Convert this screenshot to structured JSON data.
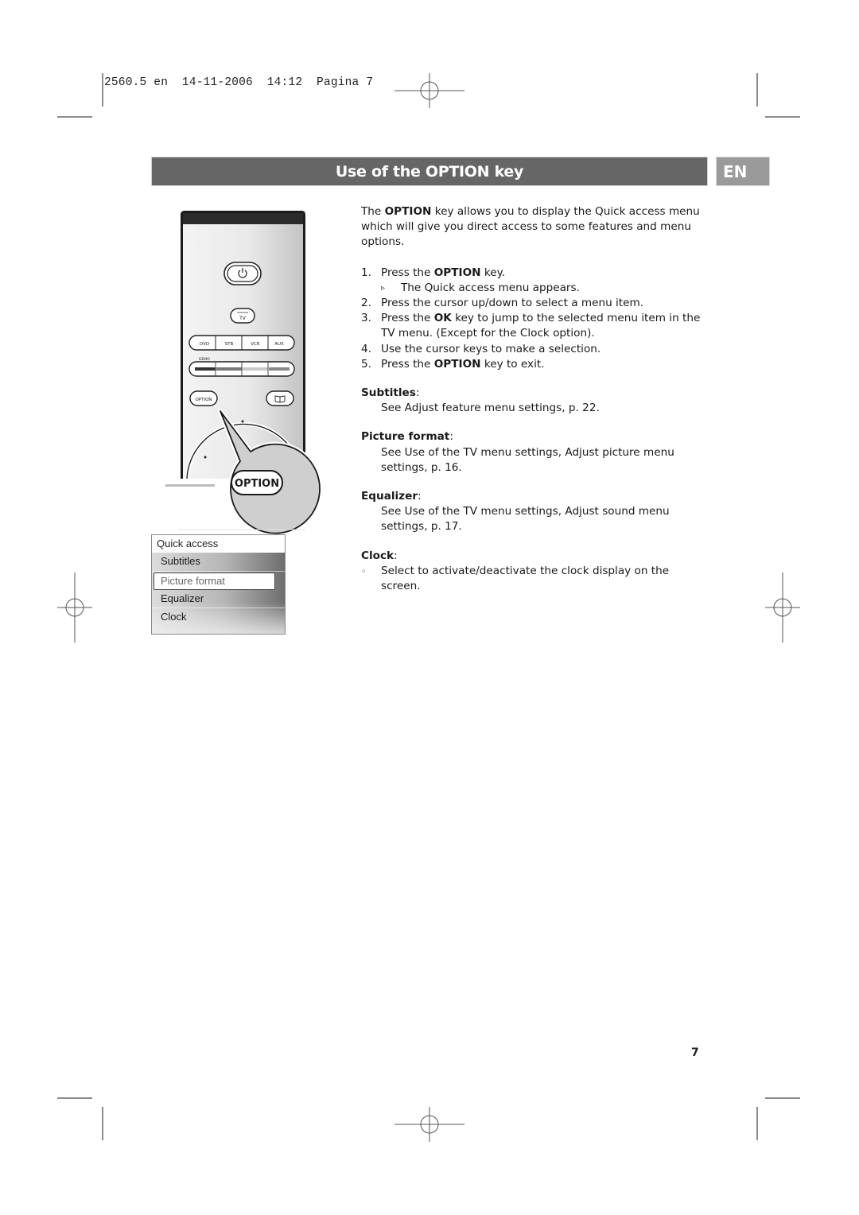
{
  "slug": {
    "text": "2560.5 en  14-11-2006  14:12  Pagina 7"
  },
  "header": {
    "title": "Use of the OPTION key",
    "language_badge": "EN"
  },
  "remote": {
    "buttons": {
      "power_icon": "power-icon",
      "tv": "TV",
      "sources": [
        "DVD",
        "STB",
        "VCR",
        "AUX"
      ],
      "demo_label": "DEMO",
      "option_small": "OPTION",
      "guide_icon": "book-icon",
      "option_callout": "OPTION"
    }
  },
  "quick_access_menu": {
    "header": "Quick access",
    "items": [
      {
        "label": "Subtitles",
        "selected": false
      },
      {
        "label": "Picture format",
        "selected": true
      },
      {
        "label": "Equalizer",
        "selected": false
      },
      {
        "label": "Clock",
        "selected": false
      }
    ]
  },
  "content": {
    "intro_pre": "The ",
    "intro_bold": "OPTION",
    "intro_post": " key allows you to display the Quick access menu which will give you direct access to some features and menu options.",
    "steps": [
      {
        "num": "1.",
        "pre": "Press the ",
        "bold": "OPTION",
        "post": " key."
      },
      {
        "num": "2.",
        "pre": "Press the cursor up/down to select a menu item.",
        "bold": "",
        "post": ""
      },
      {
        "num": "3.",
        "pre": "Press the ",
        "bold": "OK",
        "post": " key to jump to the selected menu item in the TV menu. (Except for the Clock option)."
      },
      {
        "num": "4.",
        "pre": "Use the cursor keys to make a selection.",
        "bold": "",
        "post": ""
      },
      {
        "num": "5.",
        "pre": "Press the ",
        "bold": "OPTION",
        "post": " key to exit."
      }
    ],
    "step1_result": "The Quick access menu appears.",
    "sections": [
      {
        "title": "Subtitles",
        "body": "See Adjust feature menu settings, p. 22."
      },
      {
        "title": "Picture format",
        "body": "See Use of the TV menu settings, Adjust picture menu settings, p. 16."
      },
      {
        "title": "Equalizer",
        "body": "See Use of the TV menu settings, Adjust sound menu settings, p. 17."
      },
      {
        "title": "Clock",
        "body": "Select to activate/deactivate the clock display on the screen."
      }
    ],
    "colon": ":",
    "result_marker": "▹",
    "bullet_marker": "◦"
  },
  "footer": {
    "page_number": "7"
  }
}
